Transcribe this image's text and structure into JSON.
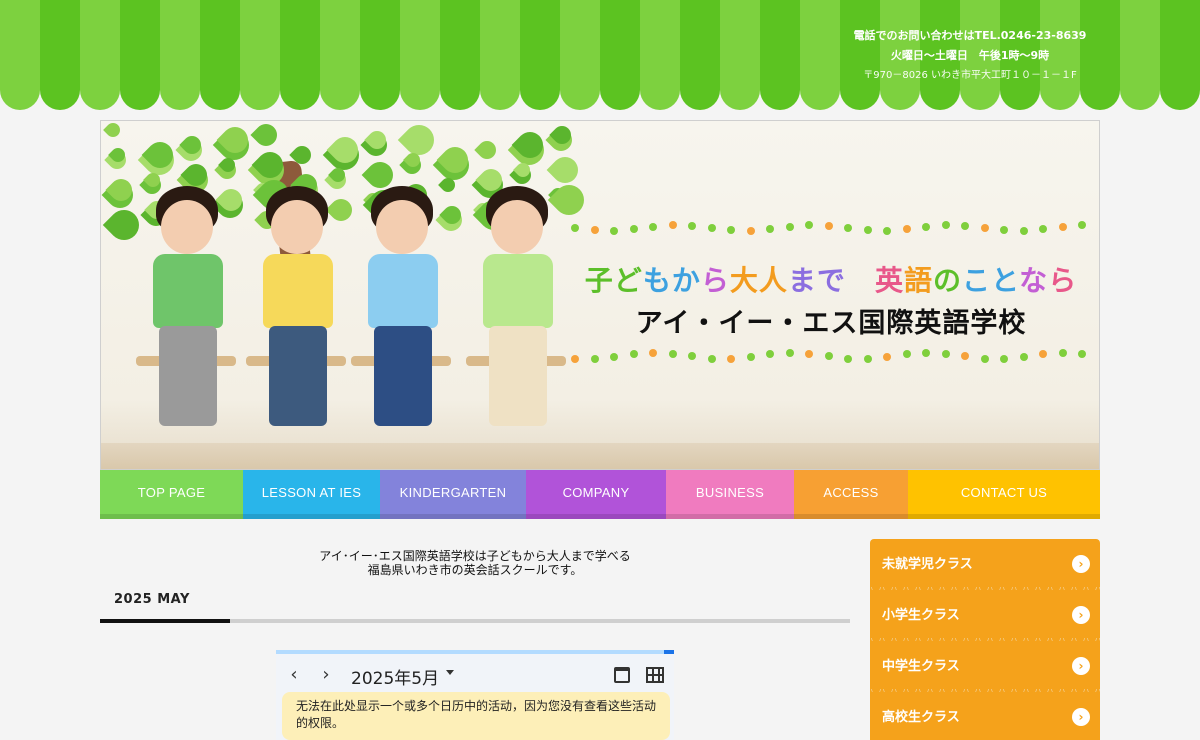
{
  "header": {
    "phone_line": "電話でのお問い合わせはTEL.0246-23-8639",
    "hours_line": "火曜日～土曜日　午後1時～9時",
    "address_line": "〒970－8026 いわき市平大工町１０－１－１F"
  },
  "hero": {
    "tagline_parts": [
      {
        "text": "子",
        "color": "#5cbf2a"
      },
      {
        "text": "ど",
        "color": "#5cbf2a"
      },
      {
        "text": "も",
        "color": "#3da1e0"
      },
      {
        "text": "か",
        "color": "#3da1e0"
      },
      {
        "text": "ら",
        "color": "#c35fd4"
      },
      {
        "text": "大",
        "color": "#f39c1f"
      },
      {
        "text": "人",
        "color": "#f39c1f"
      },
      {
        "text": "ま",
        "color": "#8b6ee0"
      },
      {
        "text": "で",
        "color": "#8b6ee0"
      },
      {
        "text": "　",
        "color": "#000000"
      },
      {
        "text": "英",
        "color": "#e8588a"
      },
      {
        "text": "語",
        "color": "#f39c1f"
      },
      {
        "text": "の",
        "color": "#5cbf2a"
      },
      {
        "text": "こ",
        "color": "#3da1e0"
      },
      {
        "text": "と",
        "color": "#3da1e0"
      },
      {
        "text": "な",
        "color": "#c35fd4"
      },
      {
        "text": "ら",
        "color": "#e8588a"
      }
    ],
    "school_name": "アイ・イー・エス国際英語学校"
  },
  "nav": {
    "items": [
      {
        "label": "TOP PAGE",
        "color": "#7ed957"
      },
      {
        "label": "LESSON AT IES",
        "color": "#29b5ea"
      },
      {
        "label": "KINDERGARTEN",
        "color": "#8383db"
      },
      {
        "label": "COMPANY",
        "color": "#b153d9"
      },
      {
        "label": "BUSINESS",
        "color": "#f07bbf"
      },
      {
        "label": "ACCESS",
        "color": "#f7a033"
      },
      {
        "label": "CONTACT US",
        "color": "#ffc200"
      }
    ]
  },
  "main": {
    "intro_line1": "アイ･イー･エス国際英語学校は子どもから大人まで学べる",
    "intro_line2": "福島県いわき市の英会話スクールです。",
    "tab_label": "2025 MAY",
    "calendar": {
      "prev": "‹",
      "next": "›",
      "month_label": "2025年5月",
      "message": "无法在此处显示一个或多个日历中的活动，因为您没有查看这些活动的权限。"
    }
  },
  "sidebar": {
    "items": [
      {
        "label": "未就学児クラス"
      },
      {
        "label": "小学生クラス"
      },
      {
        "label": "中学生クラス"
      },
      {
        "label": "高校生クラス"
      }
    ],
    "arrow_glyph": "›"
  }
}
